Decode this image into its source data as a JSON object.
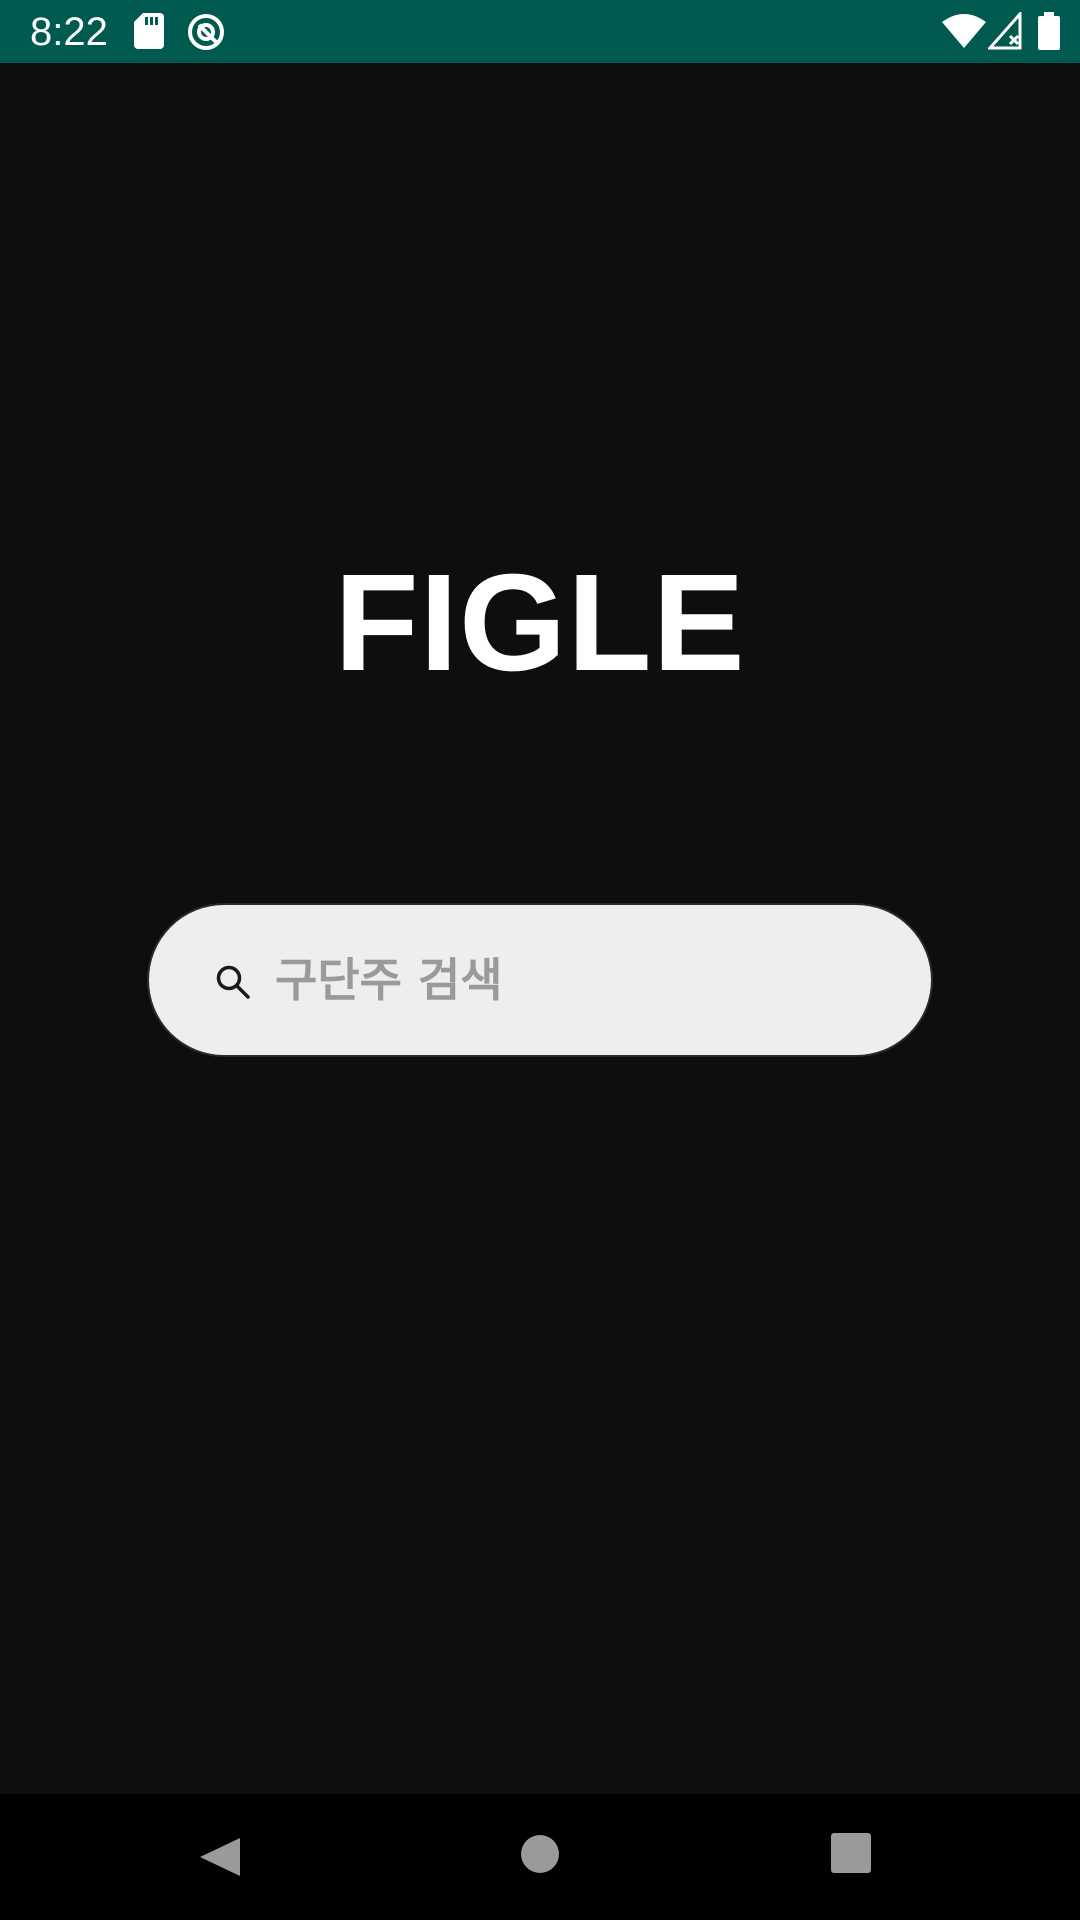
{
  "status_bar": {
    "time": "8:22",
    "icons": [
      "sd-card-icon",
      "sync-icon",
      "wifi-icon",
      "signal-icon",
      "battery-icon"
    ],
    "background": "#005a50"
  },
  "app": {
    "title": "FIGLE"
  },
  "search": {
    "placeholder": "구단주 검색",
    "value": ""
  },
  "nav_bar": {
    "buttons": [
      "back-icon",
      "home-icon",
      "recents-icon"
    ]
  },
  "colors": {
    "background": "#0e0e0e",
    "search_background": "#eeeeee",
    "placeholder": "#9a9a9a"
  }
}
